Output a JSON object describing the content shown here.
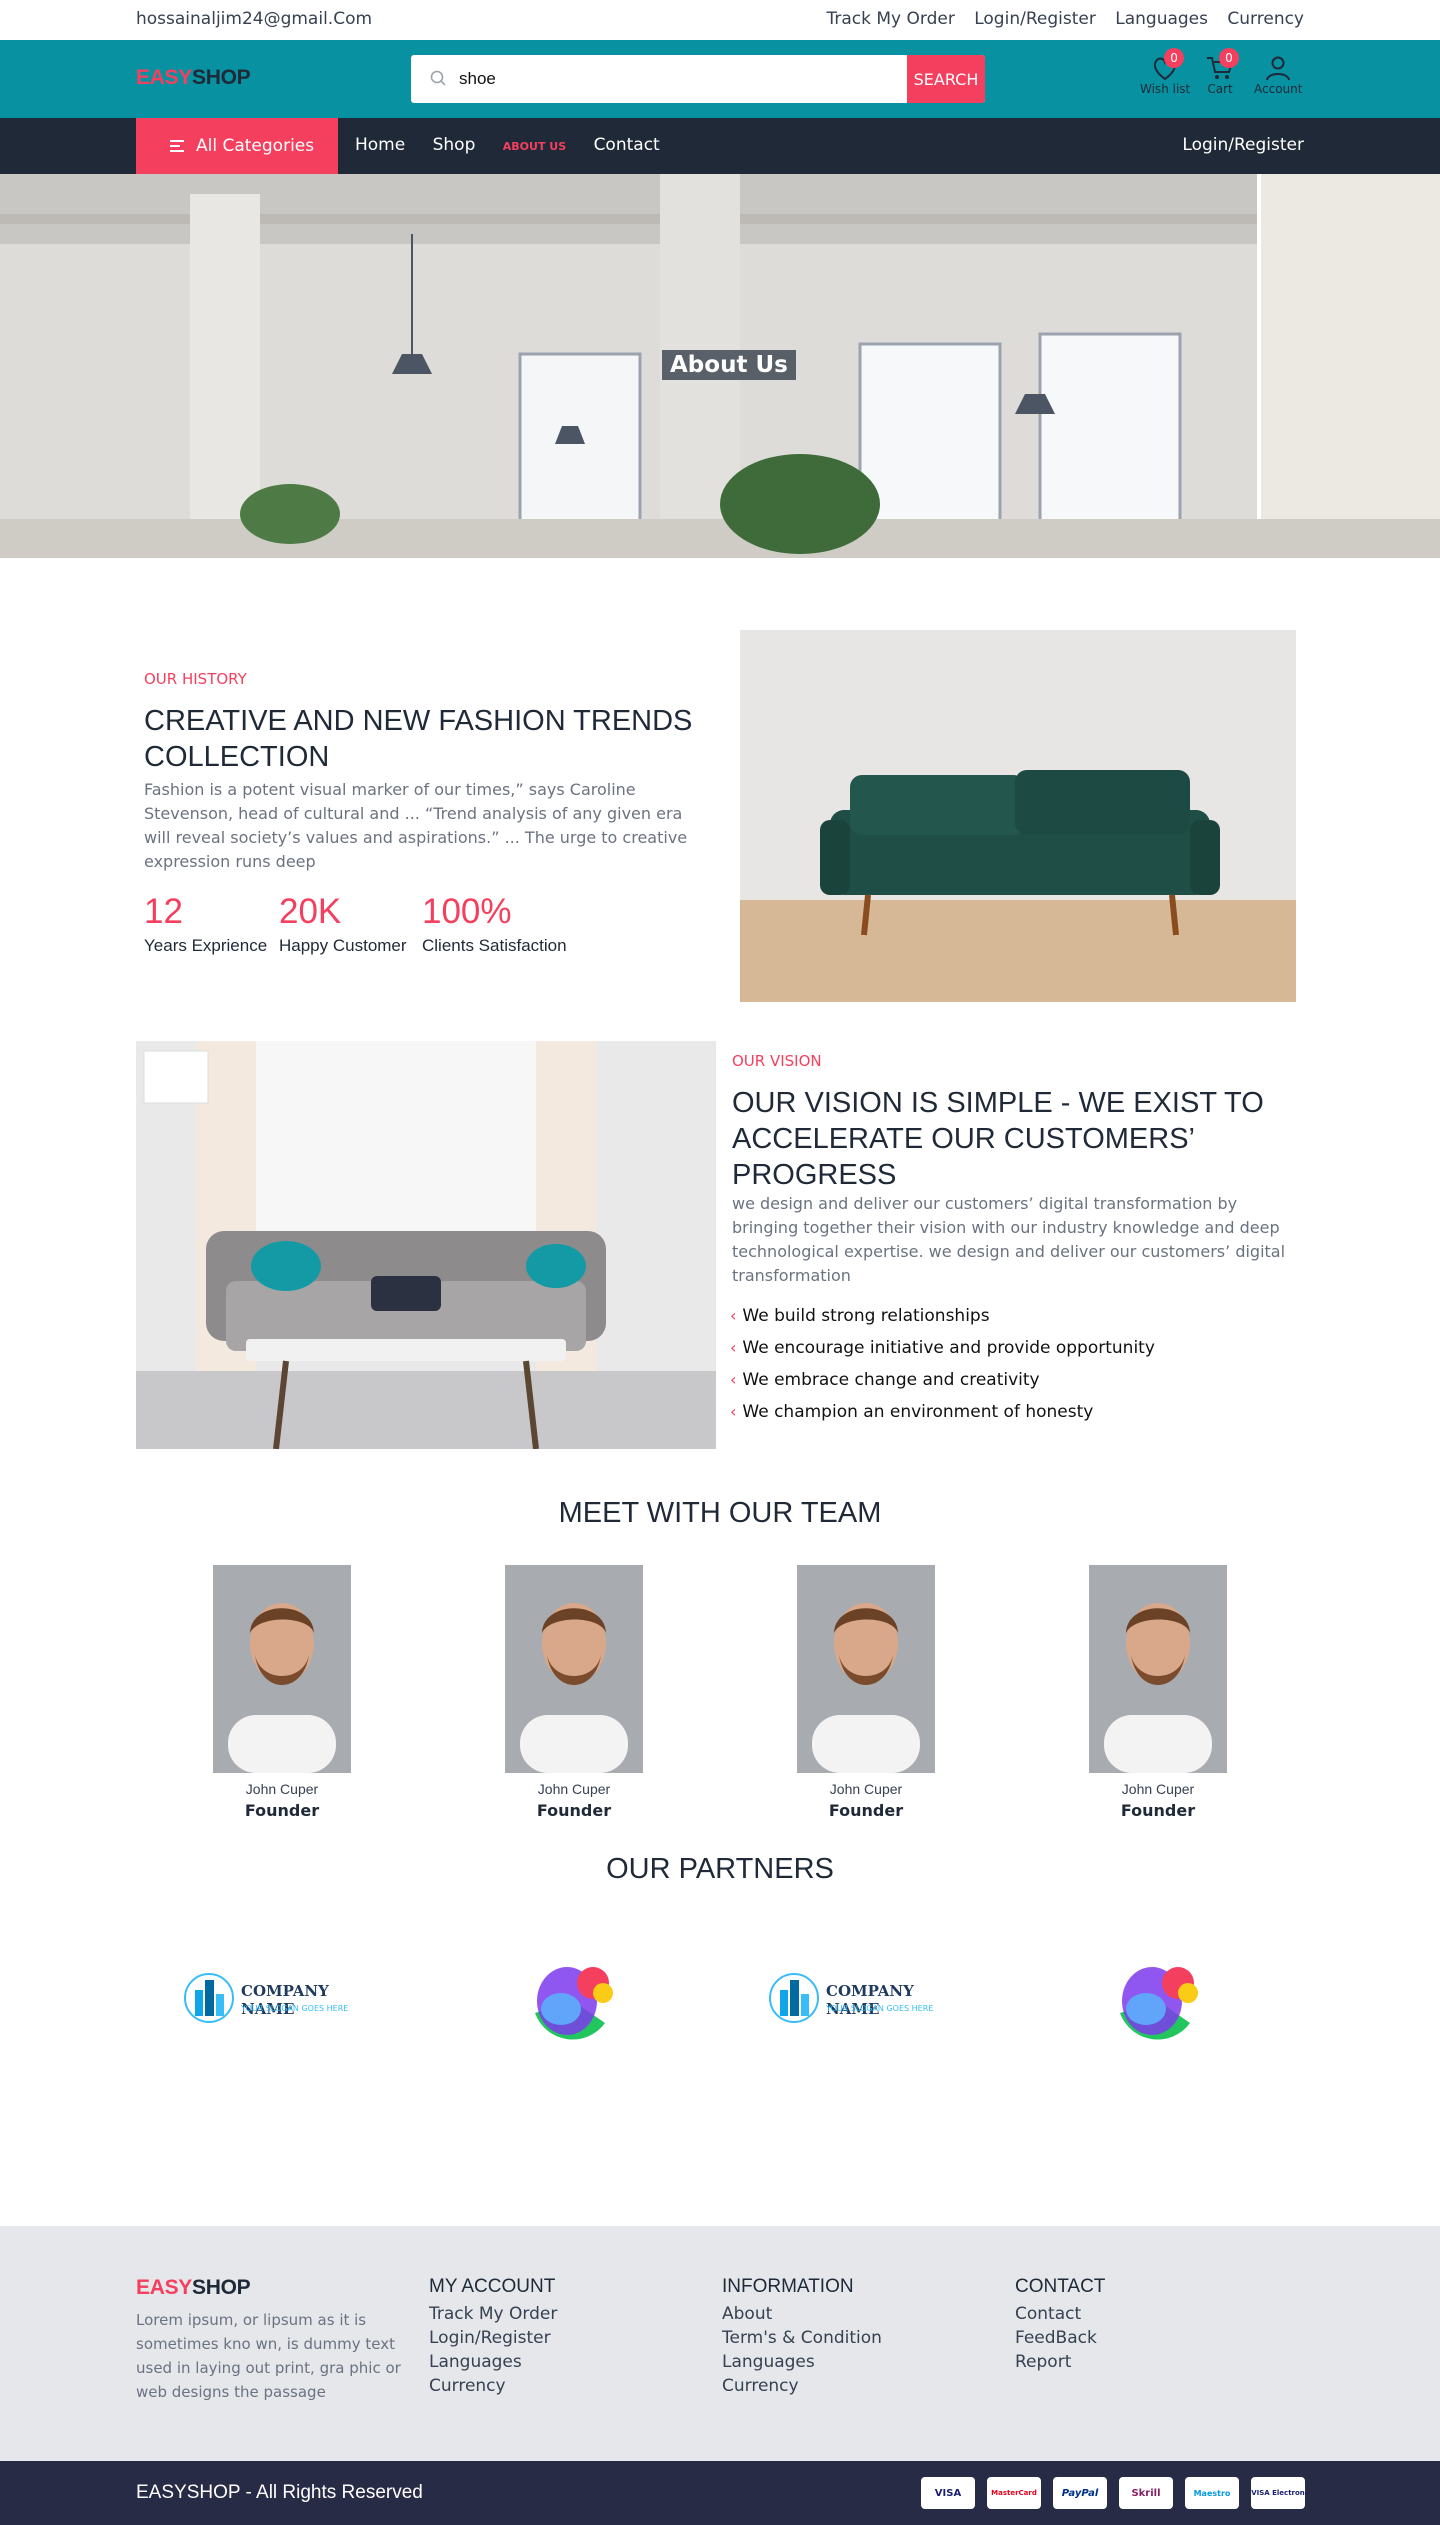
{
  "topbar": {
    "email": "hossainaljim24@gmail.Com",
    "links": [
      "Track My Order",
      "Login/Register",
      "Languages",
      "Currency"
    ]
  },
  "brand": {
    "part1": "EASY",
    "part2": "SHOP"
  },
  "search": {
    "value": "shoe",
    "button": "SEARCH"
  },
  "header_icons": {
    "wishlist_label": "Wish list",
    "wishlist_count": "0",
    "cart_label": "Cart",
    "cart_count": "0",
    "account_label": "Account"
  },
  "nav": {
    "all_categories": "All Categories",
    "items": [
      "Home",
      "Shop",
      "ABOUT US",
      "Contact"
    ],
    "login": "Login/Register"
  },
  "hero": {
    "title": "About Us"
  },
  "history": {
    "label": "OUR HISTORY",
    "title": "CREATIVE AND NEW FASHION TRENDS COLLECTION",
    "text": "Fashion is a potent visual marker of our times,” says Caroline Stevenson, head of cultural and ... “Trend analysis of any given era will reveal society’s values and aspirations.” ... The urge to creative expression runs deep",
    "stats": [
      {
        "value": "12",
        "label": "Years Exprience"
      },
      {
        "value": "20K",
        "label": "Happy Customer"
      },
      {
        "value": "100%",
        "label": "Clients Satisfaction"
      }
    ]
  },
  "vision": {
    "label": "OUR VISION",
    "title": "OUR VISION IS SIMPLE - WE EXIST TO ACCELERATE OUR CUSTOMERS’ PROGRESS",
    "text": "we design and deliver our customers’ digital transformation by bringing together their vision with our industry knowledge and deep technological expertise. we design and deliver our customers’ digital transformation",
    "points": [
      "We build strong relationships",
      "We encourage initiative and provide opportunity",
      "We embrace change and creativity",
      "We champion an environment of honesty"
    ]
  },
  "team": {
    "title": "MEET WITH OUR TEAM",
    "members": [
      {
        "name": "John Cuper",
        "role": "Founder"
      },
      {
        "name": "John Cuper",
        "role": "Founder"
      },
      {
        "name": "John Cuper",
        "role": "Founder"
      },
      {
        "name": "John Cuper",
        "role": "Founder"
      }
    ]
  },
  "partners": {
    "title": "OUR PARTNERS",
    "company_name": "COMPANY NAME",
    "slogan": "YOUR SLOGAN GOES HERE"
  },
  "footer": {
    "about": "Lorem ipsum, or lipsum as it is sometimes kno wn, is dummy text used in laying out print, gra phic or web designs the passage",
    "my_account": {
      "title": "MY ACCOUNT",
      "links": [
        "Track My Order",
        "Login/Register",
        "Languages",
        "Currency"
      ]
    },
    "information": {
      "title": "INFORMATION",
      "links": [
        "About",
        "Term's & Condition",
        "Languages",
        "Currency"
      ]
    },
    "contact": {
      "title": "CONTACT",
      "links": [
        "Contact",
        "FeedBack",
        "Report"
      ]
    }
  },
  "bottom": {
    "copyright": "EASYSHOP - All Rights Reserved",
    "payments": [
      "VISA",
      "MasterCard",
      "PayPal",
      "Skrill",
      "Maestro",
      "VISA Electron"
    ]
  },
  "colors": {
    "accent": "#f43f5e",
    "header": "#0891a1",
    "nav": "#1f2937",
    "footer": "#e5e7eb",
    "bottom": "#282b46"
  }
}
